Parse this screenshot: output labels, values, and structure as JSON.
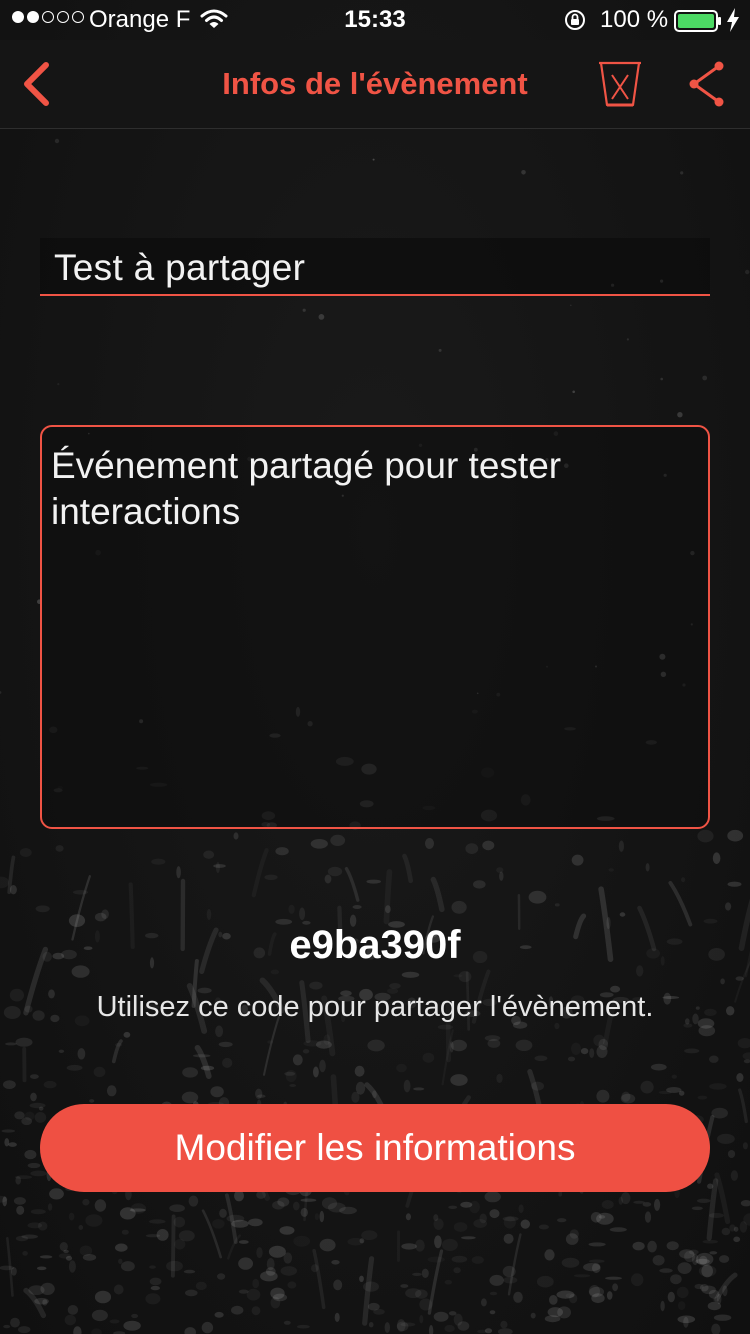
{
  "status_bar": {
    "carrier": "Orange F",
    "time": "15:33",
    "battery_percent": "100 %",
    "signal_bars_filled": 2,
    "signal_bars_total": 5,
    "icons": [
      "wifi-icon",
      "orientation-lock-icon",
      "battery-icon",
      "charging-bolt-icon"
    ]
  },
  "nav": {
    "title": "Infos de l'évènement",
    "back_icon": "chevron-left-icon",
    "delete_icon": "trash-icon",
    "share_icon": "share-icon"
  },
  "form": {
    "event_name": "Test à partager",
    "description": "Événement partagé pour tester interactions"
  },
  "share": {
    "code": "e9ba390f",
    "hint": "Utilisez ce code pour partager l'évènement."
  },
  "actions": {
    "edit_label": "Modifier les informations"
  },
  "colors": {
    "accent": "#f05445",
    "button": "#ef5043",
    "background": "#141414",
    "battery": "#4cd964"
  }
}
